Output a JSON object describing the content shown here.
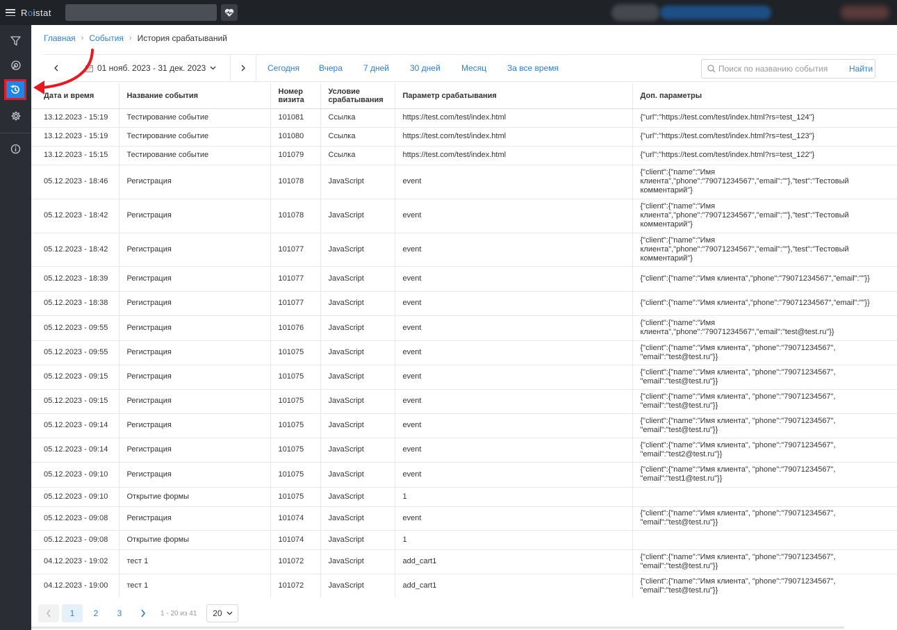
{
  "app": {
    "logo_prefix": "R",
    "logo_accent": "o",
    "logo_suffix": "istat"
  },
  "breadcrumb": {
    "home": "Главная",
    "events": "События",
    "current": "История срабатываний"
  },
  "toolbar": {
    "date_range": "01 нояб. 2023 - 31 дек. 2023",
    "quick_filters": [
      "Сегодня",
      "Вчера",
      "7 дней",
      "30 дней",
      "Месяц",
      "За все время"
    ],
    "search_placeholder": "Поиск по названию события",
    "search_button": "Найти"
  },
  "table": {
    "headers": [
      "Дата и время",
      "Название события",
      "Номер визита",
      "Условие срабатывания",
      "Параметр срабатывания",
      "Доп. параметры"
    ],
    "rows": [
      [
        "13.12.2023 - 15:19",
        "Тестирование событие",
        "101081",
        "Ссылка",
        "https://test.com/test/index.html",
        "{\"url\":\"https://test.com/test/index.html?rs=test_124\"}"
      ],
      [
        "13.12.2023 - 15:19",
        "Тестирование событие",
        "101080",
        "Ссылка",
        "https://test.com/test/index.html",
        "{\"url\":\"https://test.com/test/index.html?rs=test_123\"}"
      ],
      [
        "13.12.2023 - 15:15",
        "Тестирование событие",
        "101079",
        "Ссылка",
        "https://test.com/test/index.html",
        "{\"url\":\"https://test.com/test/index.html?rs=test_122\"}"
      ],
      [
        "05.12.2023 - 18:46",
        "Регистрация",
        "101078",
        "JavaScript",
        "event",
        "{\"client\":{\"name\":\"Имя клиента\",\"phone\":\"79071234567\",\"email\":\"\"},\"test\":\"Тестовый комментарий\"}"
      ],
      [
        "05.12.2023 - 18:42",
        "Регистрация",
        "101078",
        "JavaScript",
        "event",
        "{\"client\":{\"name\":\"Имя клиента\",\"phone\":\"79071234567\",\"email\":\"\"},\"test\":\"Тестовый комментарий\"}"
      ],
      [
        "05.12.2023 - 18:42",
        "Регистрация",
        "101077",
        "JavaScript",
        "event",
        "{\"client\":{\"name\":\"Имя клиента\",\"phone\":\"79071234567\",\"email\":\"\"},\"test\":\"Тестовый комментарий\"}"
      ],
      [
        "05.12.2023 - 18:39",
        "Регистрация",
        "101077",
        "JavaScript",
        "event",
        "{\"client\":{\"name\":\"Имя клиента\",\"phone\":\"79071234567\",\"email\":\"\"}}"
      ],
      [
        "05.12.2023 - 18:38",
        "Регистрация",
        "101077",
        "JavaScript",
        "event",
        "{\"client\":{\"name\":\"Имя клиента\",\"phone\":\"79071234567\",\"email\":\"\"}}"
      ],
      [
        "05.12.2023 - 09:55",
        "Регистрация",
        "101076",
        "JavaScript",
        "event",
        "{\"client\":{\"name\":\"Имя клиента\",\"phone\":\"79071234567\",\"email\":\"test@test.ru\"}}"
      ],
      [
        "05.12.2023 - 09:55",
        "Регистрация",
        "101075",
        "JavaScript",
        "event",
        "{\"client\":{\"name\":\"Имя клиента\", \"phone\":\"79071234567\", \"email\":\"test@test.ru\"}}"
      ],
      [
        "05.12.2023 - 09:15",
        "Регистрация",
        "101075",
        "JavaScript",
        "event",
        "{\"client\":{\"name\":\"Имя клиента\", \"phone\":\"79071234567\", \"email\":\"test@test.ru\"}}"
      ],
      [
        "05.12.2023 - 09:15",
        "Регистрация",
        "101075",
        "JavaScript",
        "event",
        "{\"client\":{\"name\":\"Имя клиента\", \"phone\":\"79071234567\", \"email\":\"test@test.ru\"}}"
      ],
      [
        "05.12.2023 - 09:14",
        "Регистрация",
        "101075",
        "JavaScript",
        "event",
        "{\"client\":{\"name\":\"Имя клиента\", \"phone\":\"79071234567\", \"email\":\"test@test.ru\"}}"
      ],
      [
        "05.12.2023 - 09:14",
        "Регистрация",
        "101075",
        "JavaScript",
        "event",
        "{\"client\":{\"name\":\"Имя клиента\", \"phone\":\"79071234567\", \"email\":\"test2@test.ru\"}}"
      ],
      [
        "05.12.2023 - 09:10",
        "Регистрация",
        "101075",
        "JavaScript",
        "event",
        "{\"client\":{\"name\":\"Имя клиента\", \"phone\":\"79071234567\", \"email\":\"test1@test.ru\"}}"
      ],
      [
        "05.12.2023 - 09:10",
        "Открытие формы",
        "101075",
        "JavaScript",
        "1",
        ""
      ],
      [
        "05.12.2023 - 09:08",
        "Регистрация",
        "101074",
        "JavaScript",
        "event",
        "{\"client\":{\"name\":\"Имя клиента\", \"phone\":\"79071234567\", \"email\":\"test@test.ru\"}}"
      ],
      [
        "05.12.2023 - 09:08",
        "Открытие формы",
        "101074",
        "JavaScript",
        "1",
        ""
      ],
      [
        "04.12.2023 - 19:02",
        "тест 1",
        "101072",
        "JavaScript",
        "add_cart1",
        "{\"client\":{\"name\":\"Имя клиента\", \"phone\":\"79071234567\", \"email\":\"test@test.ru\"}}"
      ],
      [
        "04.12.2023 - 19:00",
        "тест 1",
        "101072",
        "JavaScript",
        "add_cart1",
        "{\"client\":{\"name\":\"Имя клиента\", \"phone\":\"79071234567\", \"email\":\"test@test.ru\"}}"
      ]
    ]
  },
  "pagination": {
    "pages": [
      "1",
      "2",
      "3"
    ],
    "active_page": "1",
    "info": "1 - 20 из 41",
    "per_page": "20"
  },
  "icons": {
    "sidebar": [
      "filter-icon",
      "target-icon",
      "history-icon",
      "gear-icon",
      "info-icon"
    ],
    "accent": "#1e86e6",
    "highlight": "#e8181c"
  }
}
